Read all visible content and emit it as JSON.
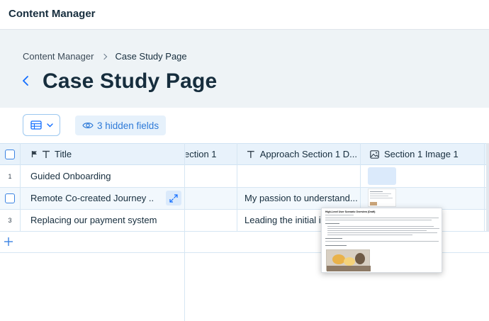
{
  "app": {
    "title": "Content Manager"
  },
  "breadcrumb": {
    "parent": "Content Manager",
    "current": "Case Study Page"
  },
  "page": {
    "title": "Case Study Page"
  },
  "toolbar": {
    "hidden_fields_label": "3 hidden fields"
  },
  "table": {
    "columns": [
      {
        "label": "Title",
        "icon": "text-icon"
      },
      {
        "label": "ection 1",
        "icon": ""
      },
      {
        "label": "Approach Section 1 D...",
        "icon": "text-icon"
      },
      {
        "label": "Section 1 Image 1",
        "icon": "image-icon"
      }
    ],
    "rows": [
      {
        "num": "1",
        "title": "Guided Onboarding",
        "approach": ""
      },
      {
        "num": "",
        "title": "Remote Co-created Journey ...",
        "approach": "My passion to understand..."
      },
      {
        "num": "3",
        "title": "Replacing our payment system",
        "approach": "Leading the initial in"
      }
    ]
  },
  "preview": {
    "doc_title": "High-Level User Scenario Overview (Draft)"
  },
  "colors": {
    "accent": "#116dff",
    "header_bg": "#eef3f6",
    "grid_line": "#d6e6f3"
  }
}
